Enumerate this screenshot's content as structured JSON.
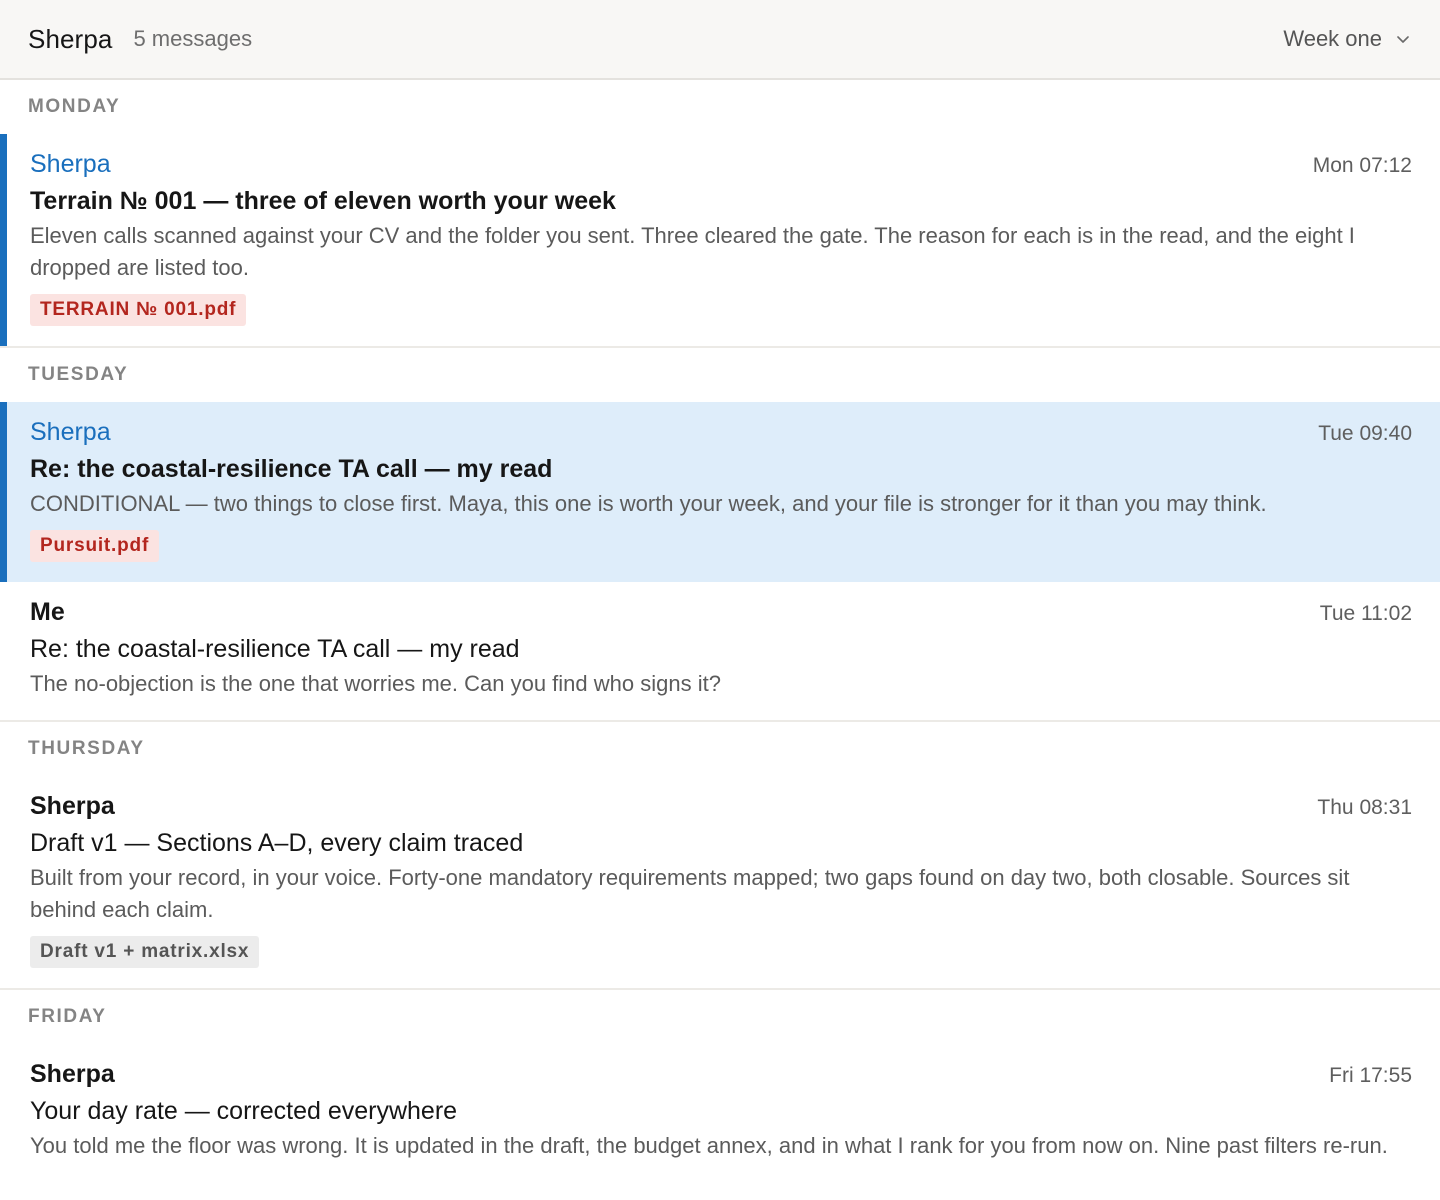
{
  "header": {
    "title": "Sherpa",
    "count": "5 messages",
    "filter_label": "Week one"
  },
  "days": {
    "monday": "MONDAY",
    "tuesday": "TUESDAY",
    "thursday": "THURSDAY",
    "friday": "FRIDAY"
  },
  "messages": [
    {
      "sender": "Sherpa",
      "time": "Mon 07:12",
      "subject": "Terrain № 001 — three of eleven worth your week",
      "preview": "Eleven calls scanned against your CV and the folder you sent. Three cleared the gate. The reason for each is in the read, and the eight I dropped are listed too.",
      "attachment": "TERRAIN № 001.pdf"
    },
    {
      "sender": "Sherpa",
      "time": "Tue 09:40",
      "subject": "Re: the coastal-resilience TA call — my read",
      "preview": "CONDITIONAL — two things to close first. Maya, this one is worth your week, and your file is stronger for it than you may think.",
      "attachment": "Pursuit.pdf"
    },
    {
      "sender": "Me",
      "time": "Tue 11:02",
      "subject": "Re: the coastal-resilience TA call — my read",
      "preview": "The no-objection is the one that worries me. Can you find who signs it?"
    },
    {
      "sender": "Sherpa",
      "time": "Thu 08:31",
      "subject": "Draft v1 — Sections A–D, every claim traced",
      "preview": "Built from your record, in your voice. Forty-one mandatory requirements mapped; two gaps found on day two, both closable. Sources sit behind each claim.",
      "attachment": "Draft v1 + matrix.xlsx"
    },
    {
      "sender": "Sherpa",
      "time": "Fri 17:55",
      "subject": "Your day rate — corrected everywhere",
      "preview": "You told me the floor was wrong. It is updated in the draft, the budget annex, and in what I rank for you from now on. Nine past filters re-run."
    }
  ],
  "colors": {
    "accent": "#1a6fbd",
    "selected_bg": "#deedfa",
    "pdf_badge_bg": "#fbe3e1",
    "pdf_badge_text": "#b3261e"
  },
  "icons": {
    "filter_chevron": "chevron-down-icon"
  }
}
